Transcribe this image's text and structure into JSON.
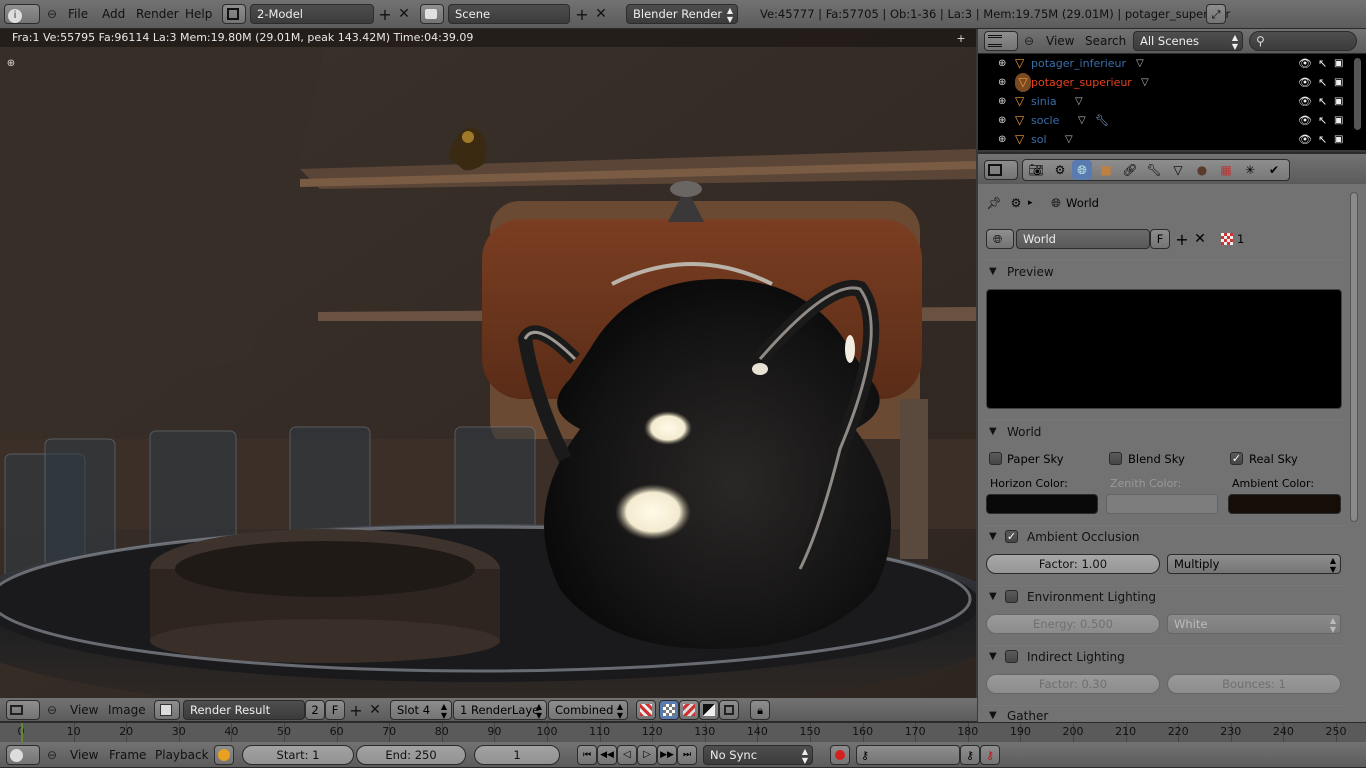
{
  "top": {
    "menus": [
      "File",
      "Add",
      "Render",
      "Help"
    ],
    "layout": "2-Model",
    "scene": "Scene",
    "engine": "Blender Render",
    "stats": "Ve:45777 | Fa:57705 | Ob:1-36 | La:3 | Mem:19.75M (29.01M) | potager_superieur"
  },
  "render": {
    "info": "Fra:1  Ve:55795 Fa:96114 La:3 Mem:19.80M (29.01M, peak 143.42M) Time:04:39.09"
  },
  "image_header": {
    "menus": [
      "View",
      "Image"
    ],
    "image_name": "Render Result",
    "users": "2",
    "fake": "F",
    "slot": "Slot 4",
    "layer": "1 RenderLaye",
    "pass": "Combined"
  },
  "outliner": {
    "menus": [
      "View",
      "Search"
    ],
    "filter": "All Scenes",
    "items": [
      {
        "name": "potager_inferieur",
        "color": "#3b6ea8"
      },
      {
        "name": "potager_superieur",
        "color": "#e8421d"
      },
      {
        "name": "sinia",
        "color": "#3b6ea8"
      },
      {
        "name": "socle",
        "color": "#3b6ea8"
      },
      {
        "name": "sol",
        "color": "#3b6ea8"
      }
    ]
  },
  "properties": {
    "breadcrumb": "World",
    "world_name": "World",
    "fake": "F",
    "users": "1",
    "preview": "Preview",
    "world_panel": "World",
    "paper_sky": "Paper Sky",
    "blend_sky": "Blend Sky",
    "real_sky": "Real Sky",
    "horizon_label": "Horizon Color:",
    "zenith_label": "Zenith Color:",
    "ambient_label": "Ambient Color:",
    "horizon_color": "#090909",
    "zenith_color": "#7d7d7d",
    "ambient_color": "#140d08",
    "ao_panel": "Ambient Occlusion",
    "ao_factor": "Factor: 1.00",
    "ao_mode": "Multiply",
    "env_panel": "Environment Lighting",
    "env_energy": "Energy: 0.500",
    "env_color": "White",
    "indirect_panel": "Indirect Lighting",
    "indirect_factor": "Factor: 0.30",
    "indirect_bounces": "Bounces: 1",
    "gather_panel": "Gather"
  },
  "timeline": {
    "ticks": [
      "0",
      "10",
      "20",
      "30",
      "40",
      "50",
      "60",
      "70",
      "80",
      "90",
      "100",
      "110",
      "120",
      "130",
      "140",
      "150",
      "160",
      "170",
      "180",
      "190",
      "200",
      "210",
      "220",
      "230",
      "240",
      "250"
    ],
    "menus": [
      "View",
      "Frame",
      "Playback"
    ],
    "start": "Start: 1",
    "end": "End: 250",
    "current": "1",
    "sync": "No Sync"
  }
}
